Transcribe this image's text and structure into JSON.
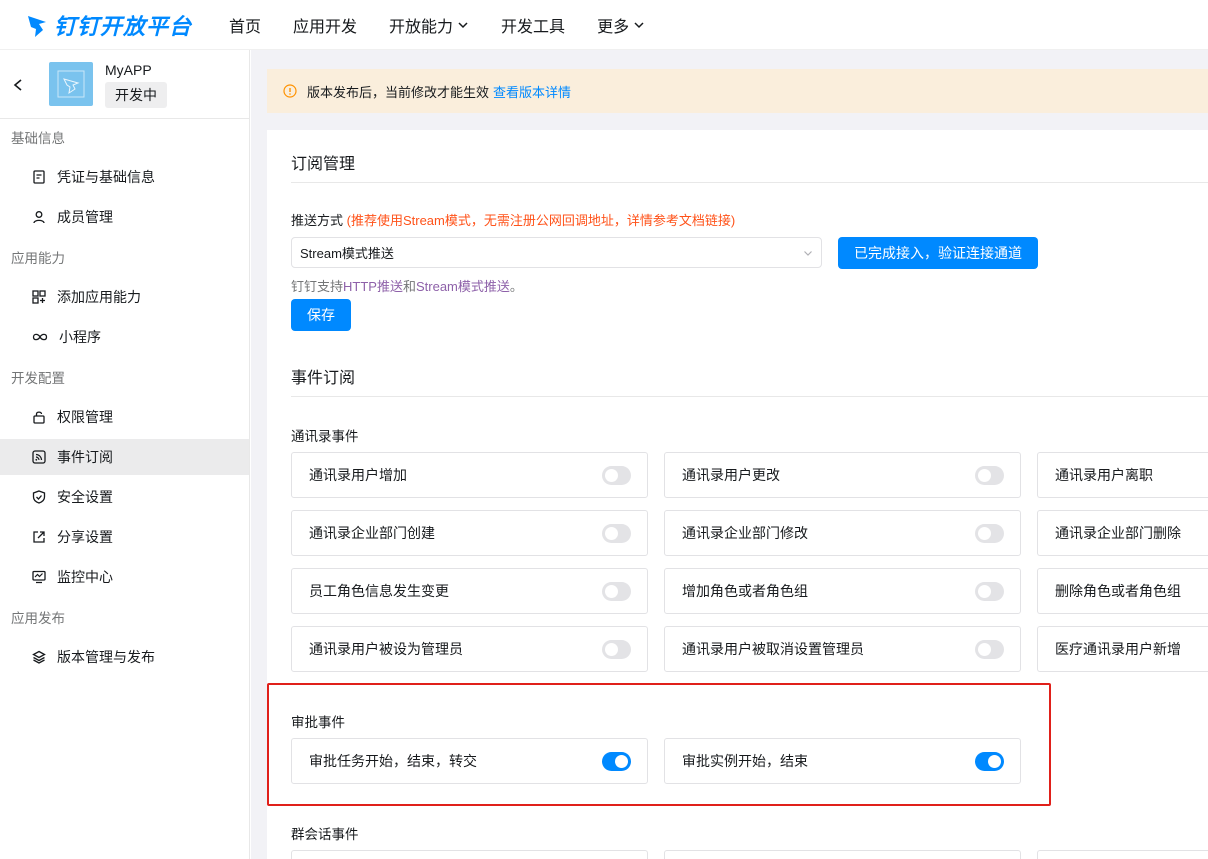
{
  "topnav": {
    "logo_text": "钉钉开放平台",
    "items": [
      {
        "label": "首页",
        "has_chevron": false
      },
      {
        "label": "应用开发",
        "has_chevron": false
      },
      {
        "label": "开放能力",
        "has_chevron": true
      },
      {
        "label": "开发工具",
        "has_chevron": false
      },
      {
        "label": "更多",
        "has_chevron": true
      }
    ]
  },
  "sidebar": {
    "app_name": "MyAPP",
    "app_status": "开发中",
    "groups": [
      {
        "title": "基础信息",
        "items": [
          {
            "label": "凭证与基础信息",
            "icon": "credential-icon"
          },
          {
            "label": "成员管理",
            "icon": "person-icon"
          }
        ]
      },
      {
        "title": "应用能力",
        "items": [
          {
            "label": "添加应用能力",
            "icon": "grid-add-icon"
          },
          {
            "label": "小程序",
            "icon": "infinity-icon"
          }
        ]
      },
      {
        "title": "开发配置",
        "items": [
          {
            "label": "权限管理",
            "icon": "lock-icon"
          },
          {
            "label": "事件订阅",
            "icon": "rss-icon",
            "active": true
          },
          {
            "label": "安全设置",
            "icon": "shield-icon"
          },
          {
            "label": "分享设置",
            "icon": "share-icon"
          },
          {
            "label": "监控中心",
            "icon": "monitor-icon"
          }
        ]
      },
      {
        "title": "应用发布",
        "items": [
          {
            "label": "版本管理与发布",
            "icon": "layers-icon"
          }
        ]
      }
    ]
  },
  "notice": {
    "text": "版本发布后，当前修改才能生效",
    "link": "查看版本详情"
  },
  "subscription": {
    "title": "订阅管理",
    "push_label": "推送方式",
    "push_hint": "(推荐使用Stream模式，无需注册公网回调地址，详情参考文档链接)",
    "select_value": "Stream模式推送",
    "verify_button": "已完成接入，验证连接通道",
    "support_prefix": "钉钉支持",
    "support_http": "HTTP推送",
    "support_and": "和",
    "support_stream": "Stream模式推送",
    "support_end": "。",
    "save_button": "保存"
  },
  "events": {
    "title": "事件订阅",
    "categories": [
      {
        "label": "通讯录事件",
        "items": [
          {
            "label": "通讯录用户增加",
            "enabled": false
          },
          {
            "label": "通讯录用户更改",
            "enabled": false
          },
          {
            "label": "通讯录用户离职",
            "enabled": false
          },
          {
            "label": "通讯录企业部门创建",
            "enabled": false
          },
          {
            "label": "通讯录企业部门修改",
            "enabled": false
          },
          {
            "label": "通讯录企业部门删除",
            "enabled": false
          },
          {
            "label": "员工角色信息发生变更",
            "enabled": false
          },
          {
            "label": "增加角色或者角色组",
            "enabled": false
          },
          {
            "label": "删除角色或者角色组",
            "enabled": false
          },
          {
            "label": "通讯录用户被设为管理员",
            "enabled": false
          },
          {
            "label": "通讯录用户被取消设置管理员",
            "enabled": false
          },
          {
            "label": "医疗通讯录用户新增",
            "enabled": false
          }
        ]
      },
      {
        "label": "审批事件",
        "items": [
          {
            "label": "审批任务开始，结束，转交",
            "enabled": true
          },
          {
            "label": "审批实例开始，结束",
            "enabled": true
          }
        ]
      },
      {
        "label": "群会话事件",
        "items": []
      }
    ]
  },
  "colors": {
    "brand": "#0089ff",
    "highlight": "#e0201a",
    "notice_bg": "#faeedc",
    "hint_red": "#ff5219"
  }
}
